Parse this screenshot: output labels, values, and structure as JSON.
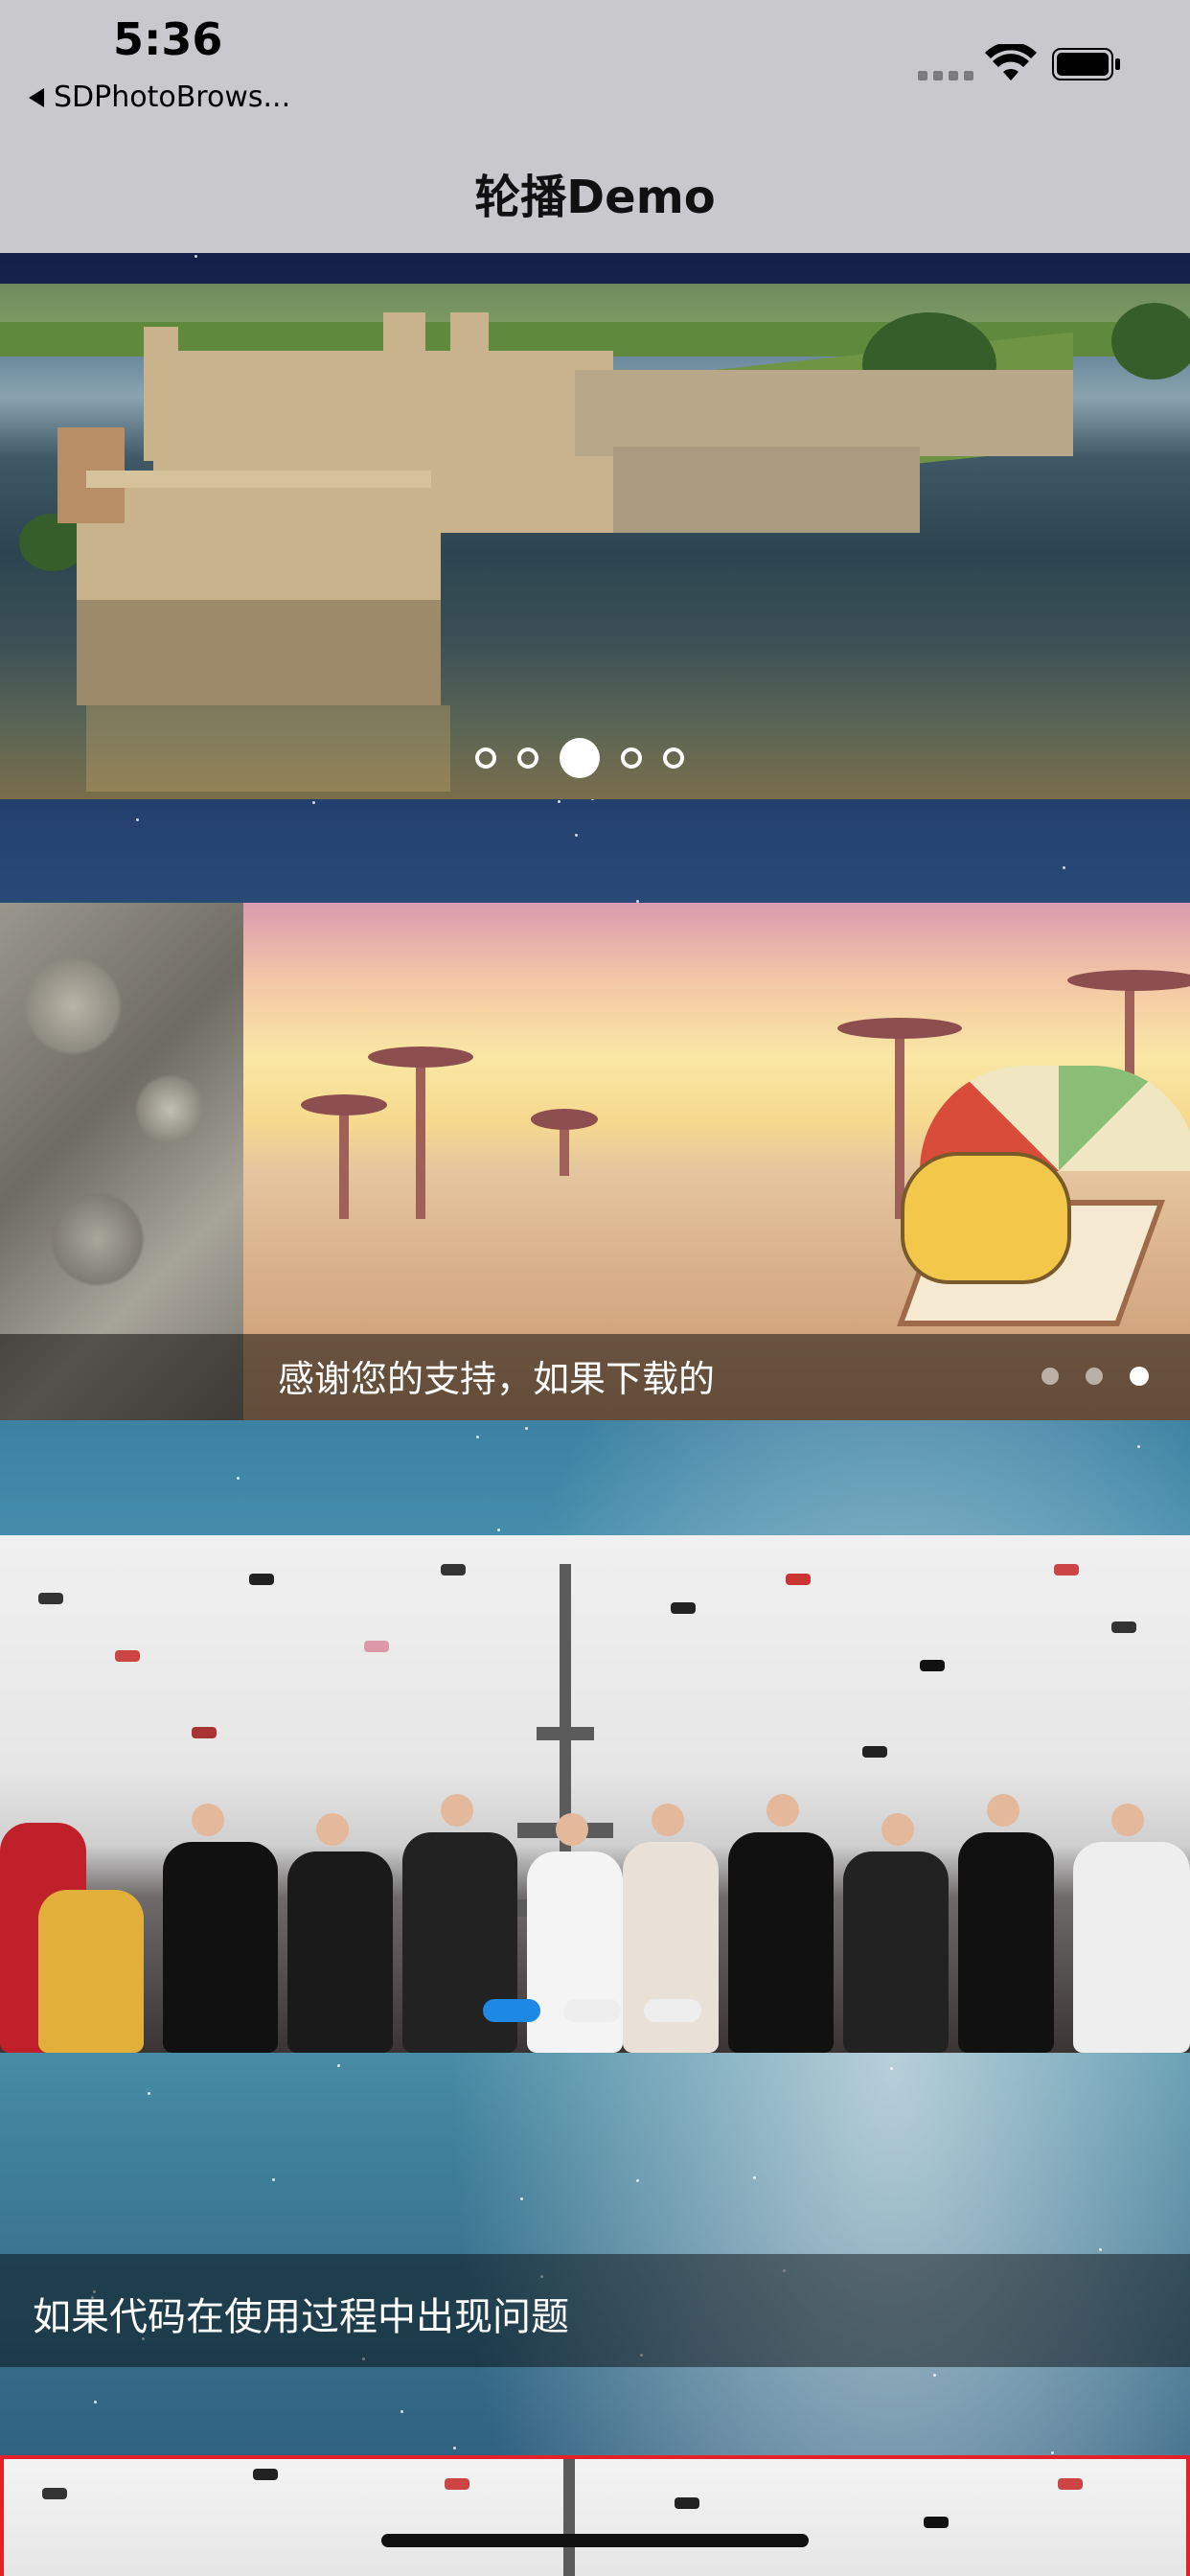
{
  "status_bar": {
    "time": "5:36",
    "back_app": "SDPhotoBrows..."
  },
  "nav": {
    "title": "轮播Demo"
  },
  "banner1": {
    "page_count": 5,
    "current_page": 3
  },
  "banner2": {
    "caption": "感谢您的支持，如果下载的",
    "page_count": 3,
    "current_page": 3
  },
  "banner3": {
    "page_count": 3,
    "current_page": 1
  },
  "banner4": {
    "caption": "如果代码在使用过程中出现问题"
  },
  "colors": {
    "accent_blue": "#1e88e5",
    "highlight_red": "#e5202a"
  }
}
